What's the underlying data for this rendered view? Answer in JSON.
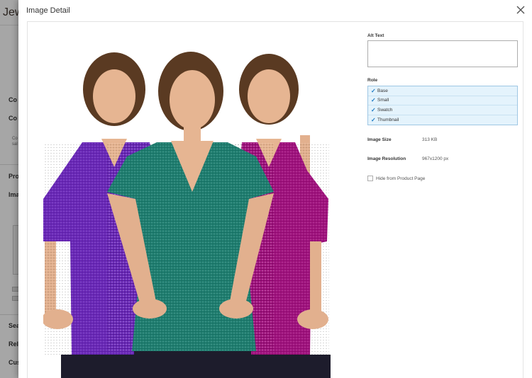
{
  "background": {
    "title": "Jew",
    "sections": [
      "Co",
      "Co",
      "Pro",
      "Ima",
      "Sea",
      "Rel",
      "Cus"
    ],
    "small_texts": [
      "Co",
      "sal"
    ]
  },
  "modal": {
    "title": "Image Detail",
    "close_icon": "close-icon",
    "alt_text": {
      "label": "Alt Text",
      "value": ""
    },
    "role": {
      "label": "Role",
      "options": [
        {
          "label": "Base",
          "checked": true
        },
        {
          "label": "Small",
          "checked": true
        },
        {
          "label": "Swatch",
          "checked": true
        },
        {
          "label": "Thumbnail",
          "checked": true
        }
      ]
    },
    "image_size": {
      "label": "Image Size",
      "value": "313 KB"
    },
    "image_resolution": {
      "label": "Image Resolution",
      "value": "967x1200 px"
    },
    "hide_from_product_page": {
      "label": "Hide from Product Page",
      "checked": false
    }
  },
  "colors": {
    "accent": "#1979c3",
    "role_bg": "#e4f3fc",
    "shirt_purple": "#6a28b8",
    "shirt_teal": "#1f7e70",
    "shirt_magenta": "#a0127e"
  }
}
